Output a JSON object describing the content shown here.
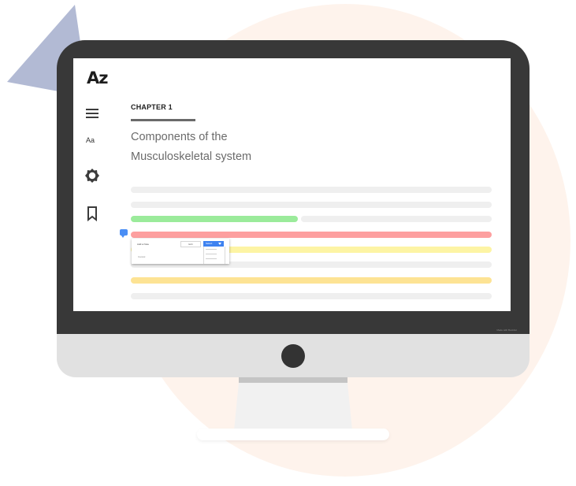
{
  "app": {
    "logo": "Az",
    "font_label": "Aa",
    "fine_print": "Made with Bookbot"
  },
  "sidebar": {
    "icons": [
      "hamburger-menu-icon",
      "font-size-icon",
      "settings-gear-icon",
      "bookmark-icon"
    ]
  },
  "content": {
    "chapter": "CHAPTER 1",
    "title_line1": "Components of the",
    "title_line2": "Musculoskeletal system"
  },
  "highlight_colors": {
    "placeholder": "#efefef",
    "green": "#9beb9b",
    "red": "#fd9f9f",
    "yellow": "#fdf4a4",
    "yellow_dark": "#fde394"
  },
  "annotation_popup": {
    "label": "Add a Note",
    "field_value": "Edit",
    "dropdown_label": "Select",
    "note": "Cancel"
  }
}
